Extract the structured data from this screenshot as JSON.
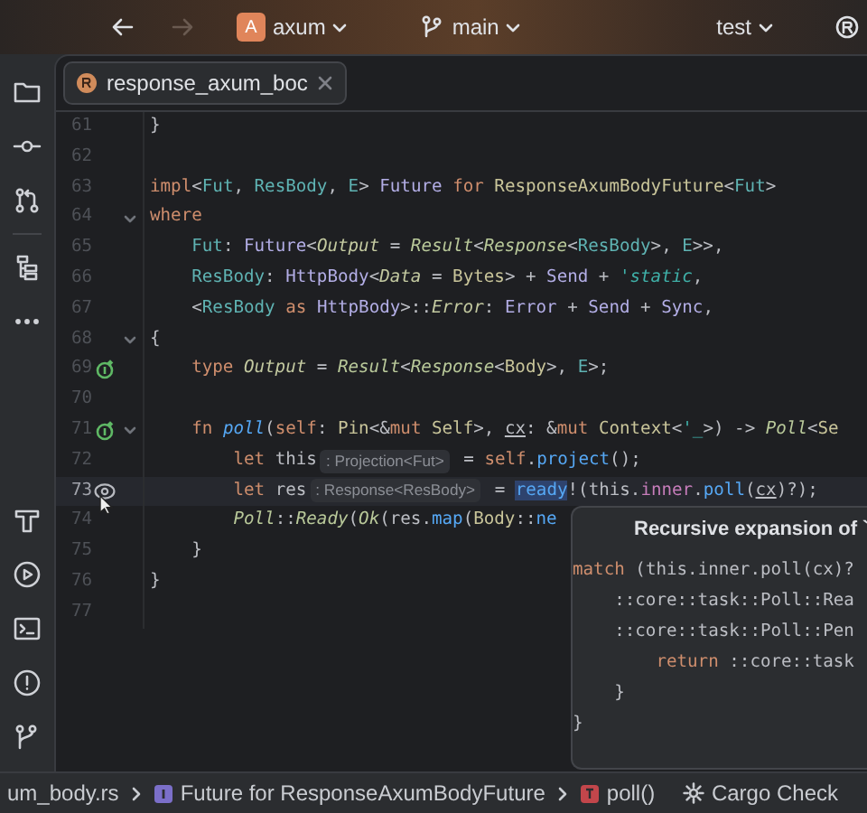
{
  "toolbar": {
    "project": {
      "badge": "A",
      "name": "axum"
    },
    "branch": "main",
    "run_config": "test"
  },
  "tabs": [
    {
      "label": "response_axum_boc",
      "selected": true
    }
  ],
  "editor": {
    "lines": [
      {
        "number": "61",
        "fold": false,
        "current": false,
        "tokens": [
          {
            "kind": "plain",
            "text": "}"
          }
        ]
      },
      {
        "number": "62",
        "fold": false,
        "current": false
      },
      {
        "number": "63",
        "fold": false,
        "current": false,
        "tokens": [
          {
            "kind": "kw",
            "text": "impl"
          },
          {
            "kind": "plain",
            "text": "<"
          },
          {
            "kind": "param",
            "text": "Fut"
          },
          {
            "kind": "plain",
            "text": ", "
          },
          {
            "kind": "param",
            "text": "ResBody"
          },
          {
            "kind": "plain",
            "text": ", "
          },
          {
            "kind": "param",
            "text": "E"
          },
          {
            "kind": "plain",
            "text": "> "
          },
          {
            "kind": "trait",
            "text": "Future "
          },
          {
            "kind": "kw",
            "text": "for "
          },
          {
            "kind": "struct",
            "text": "ResponseAxumBodyFuture"
          },
          {
            "kind": "plain",
            "text": "<"
          },
          {
            "kind": "param",
            "text": "Fut"
          },
          {
            "kind": "plain",
            "text": ">"
          }
        ]
      },
      {
        "number": "64",
        "fold": true,
        "current": false,
        "tokens": [
          {
            "kind": "kw",
            "text": "where"
          }
        ]
      },
      {
        "number": "65",
        "fold": false,
        "current": false,
        "tokens": [
          {
            "kind": "param",
            "text": "    Fut"
          },
          {
            "kind": "plain",
            "text": ": "
          },
          {
            "kind": "trait",
            "text": "Future"
          },
          {
            "kind": "plain",
            "text": "<"
          },
          {
            "kind": "assoc",
            "text": "Output"
          },
          {
            "kind": "plain",
            "text": " = "
          },
          {
            "kind": "itype",
            "text": "Result"
          },
          {
            "kind": "plain",
            "text": "<"
          },
          {
            "kind": "itype",
            "text": "Response"
          },
          {
            "kind": "plain",
            "text": "<"
          },
          {
            "kind": "param",
            "text": "ResBody"
          },
          {
            "kind": "plain",
            "text": ">, "
          },
          {
            "kind": "param",
            "text": "E"
          },
          {
            "kind": "plain",
            "text": ">>,"
          }
        ]
      },
      {
        "number": "66",
        "fold": false,
        "current": false,
        "tokens": [
          {
            "kind": "param",
            "text": "    ResBody"
          },
          {
            "kind": "plain",
            "text": ": "
          },
          {
            "kind": "trait",
            "text": "HttpBody"
          },
          {
            "kind": "plain",
            "text": "<"
          },
          {
            "kind": "assoc",
            "text": "Data"
          },
          {
            "kind": "plain",
            "text": " = "
          },
          {
            "kind": "struct",
            "text": "Bytes"
          },
          {
            "kind": "plain",
            "text": "> + "
          },
          {
            "kind": "trait",
            "text": "Send"
          },
          {
            "kind": "plain",
            "text": " + "
          },
          {
            "kind": "lifetime",
            "text": "'static"
          },
          {
            "kind": "plain",
            "text": ","
          }
        ]
      },
      {
        "number": "67",
        "fold": false,
        "current": false,
        "tokens": [
          {
            "kind": "plain",
            "text": "    <"
          },
          {
            "kind": "param",
            "text": "ResBody "
          },
          {
            "kind": "kw",
            "text": "as "
          },
          {
            "kind": "trait",
            "text": "HttpBody"
          },
          {
            "kind": "plain",
            "text": ">::"
          },
          {
            "kind": "assoc",
            "text": "Error"
          },
          {
            "kind": "plain",
            "text": ": "
          },
          {
            "kind": "trait",
            "text": "Error"
          },
          {
            "kind": "plain",
            "text": " + "
          },
          {
            "kind": "trait",
            "text": "Send"
          },
          {
            "kind": "plain",
            "text": " + "
          },
          {
            "kind": "trait",
            "text": "Sync"
          },
          {
            "kind": "plain",
            "text": ","
          }
        ]
      },
      {
        "number": "68",
        "fold": true,
        "current": false,
        "tokens": [
          {
            "kind": "plain",
            "text": "{"
          }
        ]
      },
      {
        "number": "69",
        "fold": false,
        "current": false,
        "gutter": {
          "kind": "implements"
        },
        "tokens": [
          {
            "kind": "kw",
            "text": "    type "
          },
          {
            "kind": "assoc",
            "text": "Output"
          },
          {
            "kind": "plain",
            "text": " = "
          },
          {
            "kind": "itype",
            "text": "Result"
          },
          {
            "kind": "plain",
            "text": "<"
          },
          {
            "kind": "itype",
            "text": "Response"
          },
          {
            "kind": "plain",
            "text": "<"
          },
          {
            "kind": "struct",
            "text": "Body"
          },
          {
            "kind": "plain",
            "text": ">, "
          },
          {
            "kind": "param",
            "text": "E"
          },
          {
            "kind": "plain",
            "text": ">;"
          }
        ]
      },
      {
        "number": "70",
        "fold": false,
        "current": false
      },
      {
        "number": "71",
        "fold": true,
        "current": false,
        "gutter": {
          "kind": "implements"
        },
        "tokens": [
          {
            "kind": "kw",
            "text": "    fn "
          },
          {
            "kind": "fn",
            "text": "poll"
          },
          {
            "kind": "plain",
            "text": "("
          },
          {
            "kind": "kw",
            "text": "self"
          },
          {
            "kind": "plain",
            "text": ": "
          },
          {
            "kind": "struct",
            "text": "Pin"
          },
          {
            "kind": "plain",
            "text": "<&"
          },
          {
            "kind": "kw",
            "text": "mut "
          },
          {
            "kind": "struct",
            "text": "Self"
          },
          {
            "kind": "plain",
            "text": ">, "
          },
          {
            "kind": "var",
            "text": "cx"
          },
          {
            "kind": "plain",
            "text": ": &"
          },
          {
            "kind": "kw",
            "text": "mut "
          },
          {
            "kind": "struct",
            "text": "Context"
          },
          {
            "kind": "plain",
            "text": "<"
          },
          {
            "kind": "lifetime",
            "text": "'_"
          },
          {
            "kind": "plain",
            "text": ">) -> "
          },
          {
            "kind": "itype",
            "text": "Poll"
          },
          {
            "kind": "plain",
            "text": "<"
          },
          {
            "kind": "struct",
            "text": "Se"
          }
        ]
      },
      {
        "number": "72",
        "fold": false,
        "current": false,
        "tokens": [
          {
            "kind": "kw",
            "text": "        let"
          },
          {
            "kind": "plain",
            "text": " this"
          },
          {
            "kind": "hint",
            "text": ": Projection<Fut>"
          },
          {
            "kind": "plain",
            "text": " = "
          },
          {
            "kind": "kw",
            "text": "self"
          },
          {
            "kind": "plain",
            "text": "."
          },
          {
            "kind": "method",
            "text": "project"
          },
          {
            "kind": "plain",
            "text": "();"
          }
        ]
      },
      {
        "number": "73",
        "fold": false,
        "current": true,
        "gutter": {
          "kind": "expand"
        },
        "tokens": [
          {
            "kind": "kw",
            "text": "        let"
          },
          {
            "kind": "plain",
            "text": " res"
          },
          {
            "kind": "hint",
            "text": ": Response<ResBody>"
          },
          {
            "kind": "plain",
            "text": " = "
          },
          {
            "kind": "macro",
            "text": "ready"
          },
          {
            "kind": "plain",
            "text": "!(this."
          },
          {
            "kind": "field",
            "text": "inner"
          },
          {
            "kind": "plain",
            "text": "."
          },
          {
            "kind": "method",
            "text": "poll"
          },
          {
            "kind": "plain",
            "text": "("
          },
          {
            "kind": "var",
            "text": "cx"
          },
          {
            "kind": "plain",
            "text": ")?);"
          }
        ]
      },
      {
        "number": "74",
        "fold": false,
        "current": false,
        "tokens": [
          {
            "kind": "itype",
            "text": "        Poll"
          },
          {
            "kind": "plain",
            "text": "::"
          },
          {
            "kind": "itype",
            "text": "Ready"
          },
          {
            "kind": "plain",
            "text": "("
          },
          {
            "kind": "itype",
            "text": "Ok"
          },
          {
            "kind": "plain",
            "text": "(res."
          },
          {
            "kind": "method",
            "text": "map"
          },
          {
            "kind": "plain",
            "text": "("
          },
          {
            "kind": "struct",
            "text": "Body"
          },
          {
            "kind": "plain",
            "text": "::"
          },
          {
            "kind": "method",
            "text": "ne"
          }
        ]
      },
      {
        "number": "75",
        "fold": false,
        "current": false,
        "tokens": [
          {
            "kind": "plain",
            "text": "    }"
          }
        ]
      },
      {
        "number": "76",
        "fold": false,
        "current": false,
        "tokens": [
          {
            "kind": "plain",
            "text": "}"
          }
        ]
      },
      {
        "number": "77",
        "fold": false,
        "current": false
      }
    ]
  },
  "popup": {
    "title": "Recursive expansion of `",
    "lines": [
      [
        {
          "kind": "kw",
          "text": "match"
        },
        {
          "kind": "plain",
          "text": " (this.inner.poll(cx)?"
        }
      ],
      [
        {
          "kind": "plain",
          "text": "    ::core::task::Poll::Rea"
        }
      ],
      [
        {
          "kind": "plain",
          "text": "    ::core::task::Poll::Pen"
        }
      ],
      [
        {
          "kind": "kw",
          "text": "        return"
        },
        {
          "kind": "plain",
          "text": " ::core::task"
        }
      ],
      [
        {
          "kind": "plain",
          "text": "    }"
        }
      ],
      [
        {
          "kind": "plain",
          "text": "}"
        }
      ]
    ]
  },
  "breadcrumbs": [
    {
      "kind": "file",
      "label": "um_body.rs"
    },
    {
      "kind": "impl",
      "label": "Future for ResponseAxumBodyFuture"
    },
    {
      "kind": "function",
      "label": "poll()"
    }
  ],
  "status": {
    "action": "Cargo Check"
  }
}
